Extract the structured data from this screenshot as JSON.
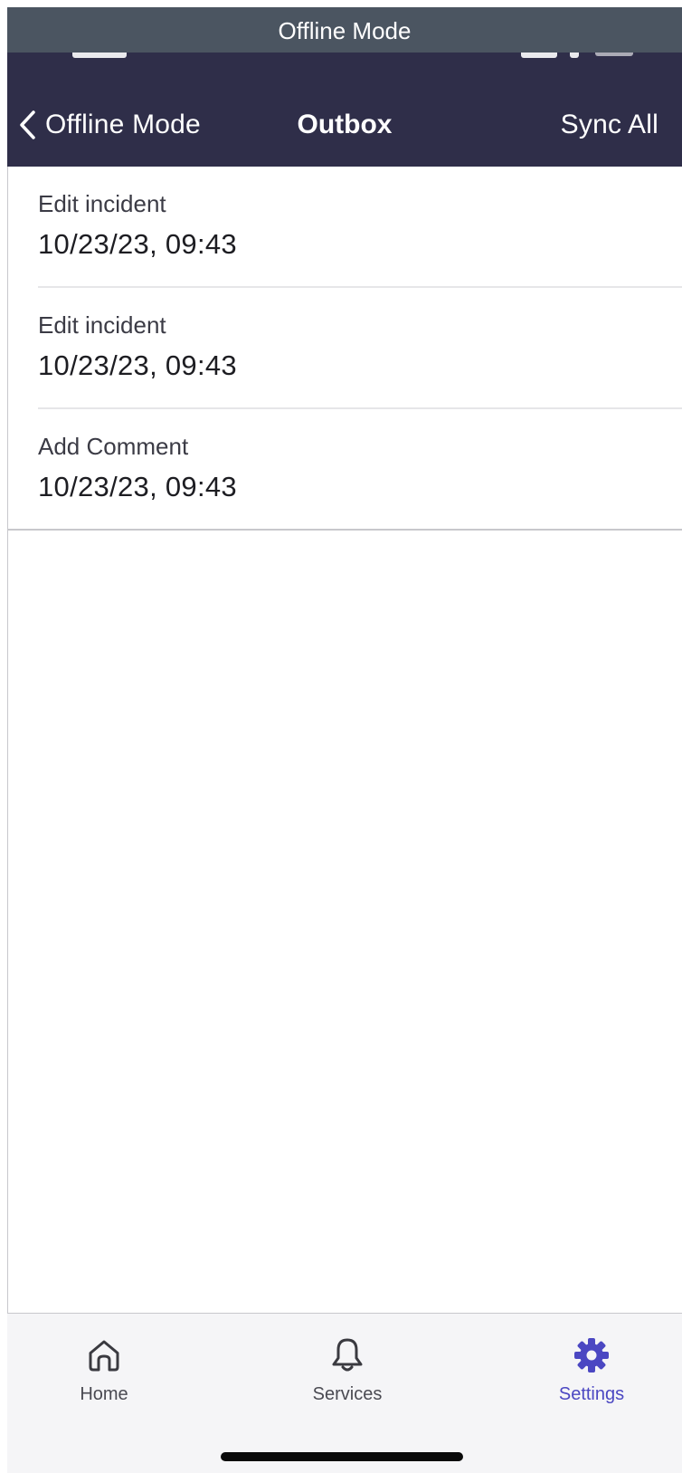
{
  "banner": {
    "text": "Offline Mode"
  },
  "header": {
    "back_label": "Offline Mode",
    "title": "Outbox",
    "action_label": "Sync All",
    "background": "#2f2e49"
  },
  "outbox": {
    "items": [
      {
        "action": "Edit incident",
        "timestamp": "10/23/23, 09:43"
      },
      {
        "action": "Edit incident",
        "timestamp": "10/23/23, 09:43"
      },
      {
        "action": "Add Comment",
        "timestamp": "10/23/23, 09:43"
      }
    ]
  },
  "tabs": [
    {
      "label": "Home",
      "icon": "home-icon",
      "active": false
    },
    {
      "label": "Services",
      "icon": "bell-icon",
      "active": false
    },
    {
      "label": "Settings",
      "icon": "gear-icon",
      "active": true
    }
  ],
  "colors": {
    "accent": "#4b47c2",
    "banner": "#4b5561"
  }
}
